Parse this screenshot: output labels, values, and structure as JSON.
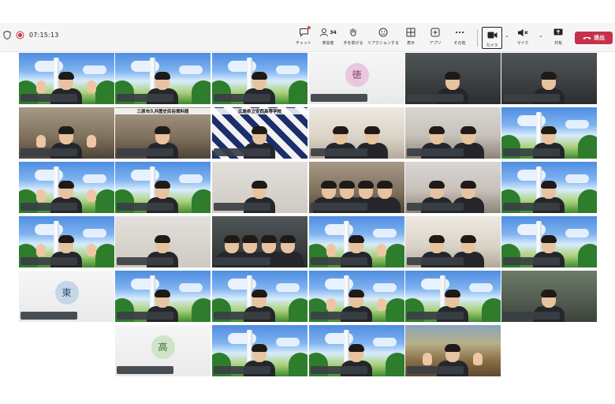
{
  "meeting": {
    "timer": "07:15:13",
    "toolbar": [
      {
        "key": "chat",
        "label": "チャット",
        "icon": "chat-icon"
      },
      {
        "key": "people",
        "label": "参加者",
        "icon": "people-icon",
        "count": "34"
      },
      {
        "key": "raise",
        "label": "手を挙げる",
        "icon": "raise-hand-icon"
      },
      {
        "key": "react",
        "label": "リアクションする",
        "icon": "reaction-icon"
      },
      {
        "key": "view",
        "label": "表示",
        "icon": "view-icon"
      },
      {
        "key": "apps",
        "label": "アプリ",
        "icon": "apps-icon"
      },
      {
        "key": "more",
        "label": "その他",
        "icon": "more-icon"
      },
      {
        "key": "camera",
        "label": "カメラ",
        "icon": "camera-icon"
      },
      {
        "key": "mic",
        "label": "マイク",
        "icon": "mic-off-icon"
      },
      {
        "key": "share",
        "label": "共有",
        "icon": "share-icon"
      }
    ],
    "leave_label": "退出"
  },
  "colors": {
    "leave": "#c4314b",
    "toolbar_bg": "#f5f5f5",
    "record_dot": "#e24a3b"
  },
  "tiles": [
    {
      "id": "r1c1",
      "bg": "sky",
      "person": true
    },
    {
      "id": "r1c2",
      "bg": "sky",
      "person": true
    },
    {
      "id": "r1c3",
      "bg": "sky",
      "person": true
    },
    {
      "id": "r1c4",
      "bg": "plain",
      "avatar": "徳",
      "avatar_color": "#e9c8dd",
      "avatar_text": "#7b3a65"
    },
    {
      "id": "r1c5",
      "bg": "dark",
      "person": true
    },
    {
      "id": "r1c6",
      "bg": "dark",
      "person": true
    },
    {
      "id": "r2c1",
      "bg": "room",
      "person": true
    },
    {
      "id": "r2c2",
      "bg": "room",
      "person": true,
      "caption": "三原市久井歴史民俗資料館"
    },
    {
      "id": "r2c3",
      "bg": "check",
      "person": true,
      "caption": "広島県立安西高等学校"
    },
    {
      "id": "r2c4",
      "bg": "office2",
      "person": true
    },
    {
      "id": "r2c5",
      "bg": "office",
      "person": true
    },
    {
      "id": "r2c6",
      "bg": "sky",
      "person": true
    },
    {
      "id": "r3c1",
      "bg": "sky",
      "person": true
    },
    {
      "id": "r3c2",
      "bg": "sky",
      "person": true
    },
    {
      "id": "r3c3",
      "bg": "wall",
      "person": true
    },
    {
      "id": "r3c4",
      "bg": "room",
      "person": true
    },
    {
      "id": "r3c5",
      "bg": "office",
      "person": true
    },
    {
      "id": "r3c6",
      "bg": "sky",
      "person": true
    },
    {
      "id": "r4c1",
      "bg": "sky",
      "person": true
    },
    {
      "id": "r4c2",
      "bg": "wall",
      "person": true
    },
    {
      "id": "r4c3",
      "bg": "dark",
      "person": true
    },
    {
      "id": "r4c4",
      "bg": "sky",
      "person": true
    },
    {
      "id": "r4c5",
      "bg": "office2",
      "person": true
    },
    {
      "id": "r4c6",
      "bg": "sky",
      "person": true
    },
    {
      "id": "r5c1",
      "bg": "plain",
      "avatar": "東",
      "avatar_color": "#c5d6e8",
      "avatar_text": "#2f4f70"
    },
    {
      "id": "r5c2",
      "bg": "sky",
      "person": true
    },
    {
      "id": "r5c3",
      "bg": "sky",
      "person": true
    },
    {
      "id": "r5c4",
      "bg": "sky",
      "person": true
    },
    {
      "id": "r5c5",
      "bg": "sky",
      "person": true
    },
    {
      "id": "r5c6",
      "bg": "kitchen",
      "person": true
    },
    {
      "id": "r6c2",
      "bg": "plain",
      "avatar": "高",
      "avatar_color": "#cfe3c9",
      "avatar_text": "#3d6a35"
    },
    {
      "id": "r6c3",
      "bg": "sky",
      "person": true
    },
    {
      "id": "r6c4",
      "bg": "sky",
      "person": true
    },
    {
      "id": "r6c5",
      "bg": "site",
      "person": true
    }
  ]
}
